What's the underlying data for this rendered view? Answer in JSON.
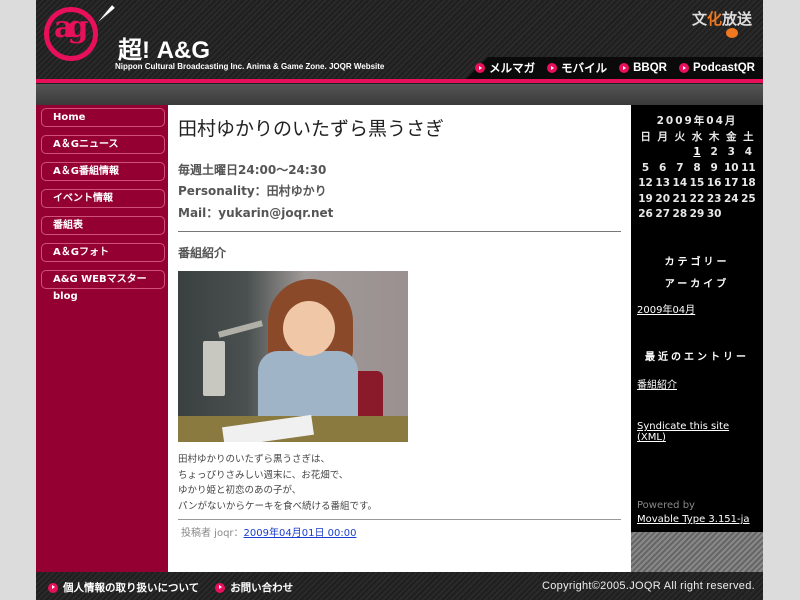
{
  "header": {
    "logo_text": "ag",
    "brand_title": "超! A&G",
    "brand_subtitle": "Nippon Cultural Broadcasting Inc. Anima & Game Zone. JOQR Website",
    "partner_logo": {
      "pre": "文",
      "accent": "化",
      "post": "放送"
    },
    "top_nav": [
      {
        "label": "メルマガ",
        "icon": "pink-arrow-bullet"
      },
      {
        "label": "モバイル",
        "icon": "pink-arrow-bullet"
      },
      {
        "label": "BBQR",
        "icon": "pink-arrow-bullet"
      },
      {
        "label": "PodcastQR",
        "icon": "pink-arrow-bullet"
      }
    ]
  },
  "sidebar": {
    "items": [
      {
        "label": "Home"
      },
      {
        "label": "A＆Gニュース"
      },
      {
        "label": "A＆G番組情報"
      },
      {
        "label": "イベント情報"
      },
      {
        "label": "番組表"
      },
      {
        "label": "A＆Gフォト"
      },
      {
        "label": "A&G WEBマスターblog"
      }
    ]
  },
  "main": {
    "title": "田村ゆかりのいたずら黒うさぎ",
    "schedule": "毎週土曜日24:00〜24:30",
    "personality": "Personality：田村ゆかり",
    "mail": "Mail：yukarin@joqr.net",
    "section_title": "番組紹介",
    "photo_alt": "田村ゆかり radio studio photo",
    "description": [
      "田村ゆかりのいたずら黒うさぎは、",
      "ちょっぴりさみしい週末に、お花畑で、",
      "ゆかり姫と初恋のあの子が、",
      "パンがないからケーキを食べ続ける番組です。"
    ],
    "posted_by": "投稿者 joqr：",
    "posted_date": "2009年04月01日 00:00"
  },
  "right_sidebar": {
    "calendar": {
      "title": "2009年04月",
      "weekdays": [
        "日",
        "月",
        "火",
        "水",
        "木",
        "金",
        "土"
      ],
      "weeks": [
        [
          "",
          "",
          "",
          "1",
          "2",
          "3",
          "4"
        ],
        [
          "5",
          "6",
          "7",
          "8",
          "9",
          "10",
          "11"
        ],
        [
          "12",
          "13",
          "14",
          "15",
          "16",
          "17",
          "18"
        ],
        [
          "19",
          "20",
          "21",
          "22",
          "23",
          "24",
          "25"
        ],
        [
          "26",
          "27",
          "28",
          "29",
          "30",
          "",
          ""
        ]
      ],
      "linked_days": [
        "1"
      ]
    },
    "category_heading": "カテゴリー",
    "archive_heading": "アーカイブ",
    "archive_link": "2009年04月",
    "recent_heading": "最近のエントリー",
    "recent_link": "番組紹介",
    "syndicate_line1": "Syndicate this site",
    "syndicate_line2": "(XML)",
    "powered_by": "Powered by",
    "powered_link": "Movable Type 3.151-ja"
  },
  "footer": {
    "links": [
      {
        "label": "個人情報の取り扱いについて"
      },
      {
        "label": "お問い合わせ"
      }
    ],
    "copyright": "Copyright©2005.JOQR All right reserved."
  },
  "colors": {
    "accent_pink": "#e8105a",
    "sidebar_crimson": "#950033",
    "link_blue": "#1a3ecc"
  }
}
